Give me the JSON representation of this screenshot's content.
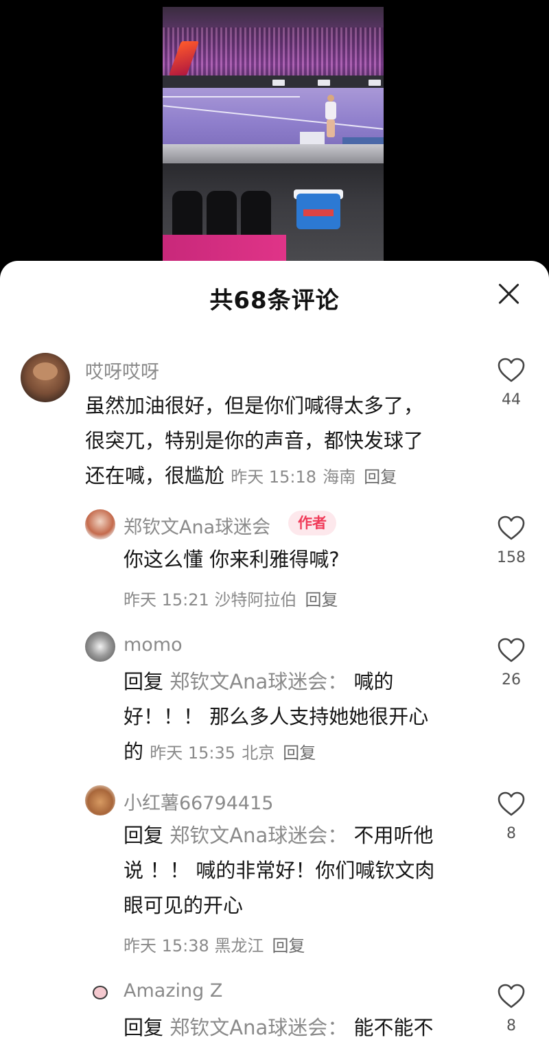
{
  "sheet": {
    "title": "共68条评论"
  },
  "comments": [
    {
      "author": "哎呀哎呀",
      "lines": [
        "虽然加油很好，但是你们喊得太多了，",
        "很突兀，特别是你的声音，都快发球了",
        "还在喊，很尴尬"
      ],
      "time": "昨天 15:18",
      "location": "海南",
      "reply_label": "回复",
      "likes": "44"
    },
    {
      "author": "郑钦文Ana球迷会",
      "badge": "作者",
      "text": "你这么懂 你来利雅得喊?",
      "time": "昨天 15:21",
      "location": "沙特阿拉伯",
      "reply_label": "回复",
      "likes": "158"
    },
    {
      "author": "momo",
      "reply_prefix": "回复",
      "reply_target": "郑钦文Ana球迷会：",
      "line1_rest": "喊的",
      "line2": "好！！！ 那么多人支持她她很开心",
      "line3": "的",
      "time": "昨天 15:35",
      "location": "北京",
      "reply_label": "回复",
      "likes": "26"
    },
    {
      "author": "小红薯66794415",
      "reply_prefix": "回复",
      "reply_target": "郑钦文Ana球迷会：",
      "line1_rest": "不用听他",
      "line2": "说 ！！ 喊的非常好！你们喊钦文肉",
      "line3": "眼可见的开心",
      "time": "昨天 15:38",
      "location": "黑龙江",
      "reply_label": "回复",
      "likes": "8"
    },
    {
      "author": "Amazing  Z",
      "reply_prefix": "回复",
      "reply_target": "郑钦文Ana球迷会：",
      "line1_rest": "能不能不",
      "likes": "8"
    }
  ],
  "icons": {
    "like": "heart-outline-icon",
    "close": "close-icon"
  }
}
